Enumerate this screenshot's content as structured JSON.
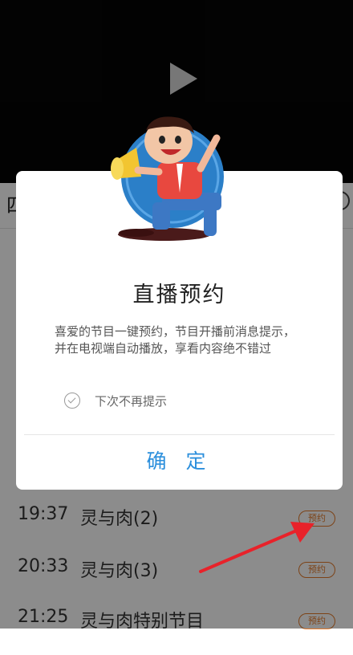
{
  "page_header": {
    "left_text": "四",
    "right_icon": "clock-icon"
  },
  "schedule": [
    {
      "time": "19:37",
      "title": "灵与肉(2)",
      "badge": "预约"
    },
    {
      "time": "20:33",
      "title": "灵与肉(3)",
      "badge": "预约"
    },
    {
      "time": "21:25",
      "title": "灵与肉特别节目",
      "badge": "预约"
    }
  ],
  "dialog": {
    "title": "直播预约",
    "description": "喜爱的节目一键预约，节目开播前消息提示，并在电视端自动播放，享看内容绝不错过",
    "checkbox_label": "下次不再提示",
    "confirm_label": "确 定"
  },
  "colors": {
    "accent": "#2c8fdc",
    "badge": "#e37a2b",
    "arrow": "#e8222a"
  }
}
